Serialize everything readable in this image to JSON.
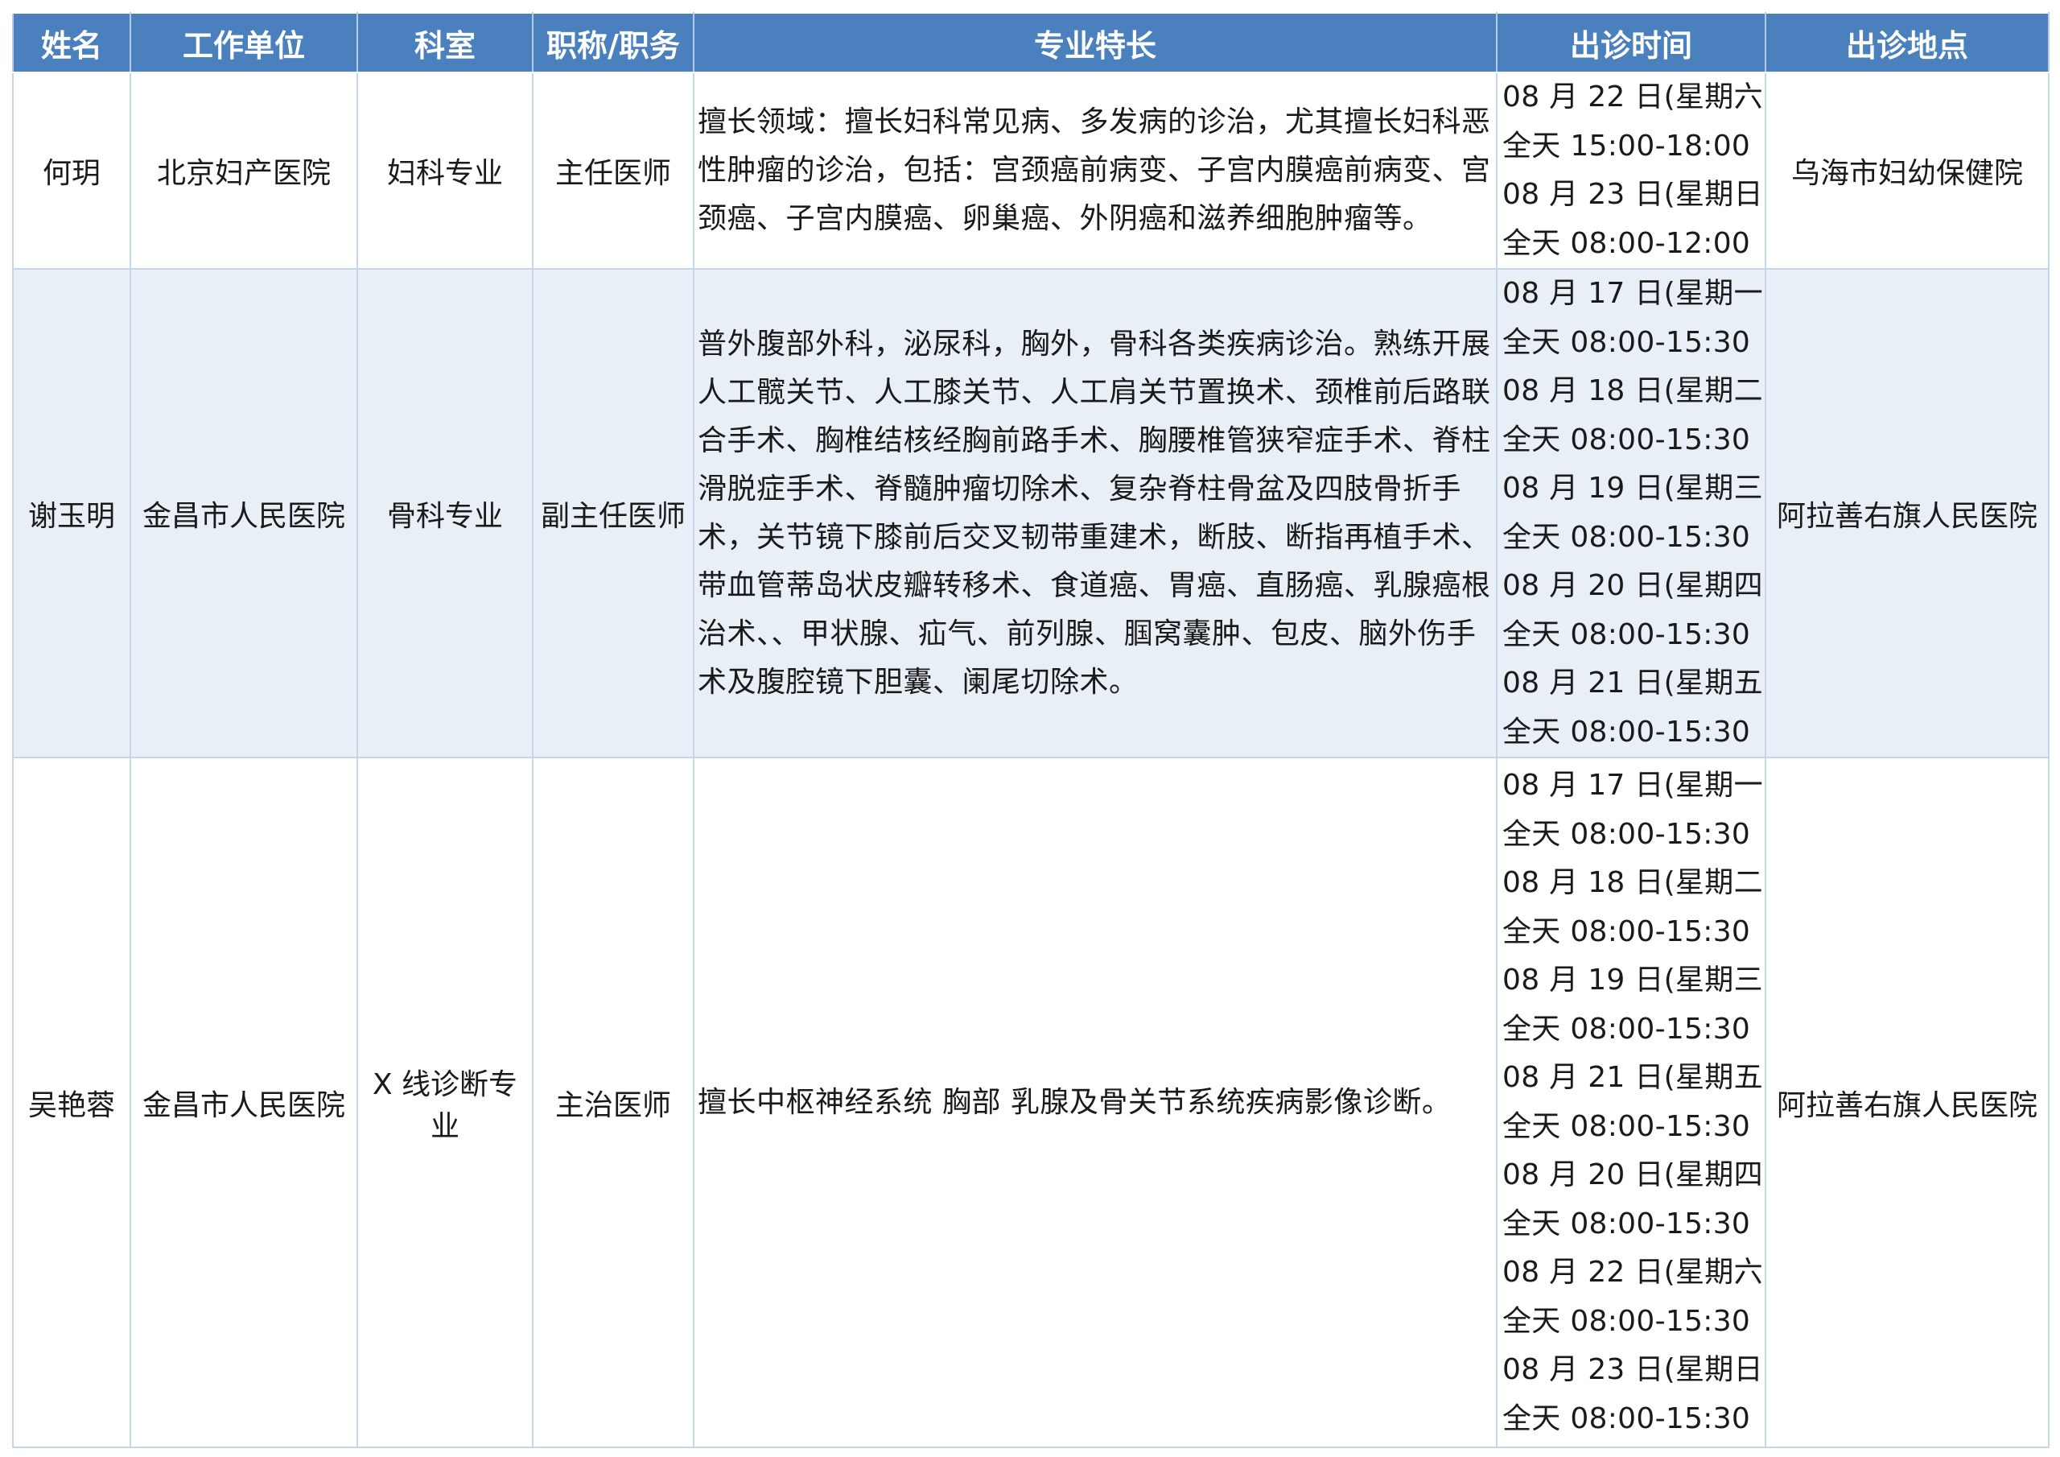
{
  "headers": [
    "姓名",
    "工作单位",
    "科室",
    "职称/职务",
    "专业特长",
    "出诊时间",
    "出诊地点"
  ],
  "doctors": [
    {
      "name": "何玥",
      "unit": "北京妇产医院",
      "dept": "妇科专业",
      "title": "主任医师",
      "specialty": "擅长领域：擅长妇科常见病、多发病的诊治，尤其擅长妇科恶性肿瘤的诊治，包括：宫颈癌前病变、子宫内膜癌前病变、宫颈癌、子宫内膜癌、卵巢癌、外阴癌和滋养细胞肿瘤等。",
      "schedule": [
        "08 月 22 日(星期六)",
        "全天 15:00-18:00",
        "08 月 23 日(星期日)",
        "全天 08:00-12:00"
      ],
      "location": "乌海市妇幼保健院"
    },
    {
      "name": "谢玉明",
      "unit": "金昌市人民医院",
      "dept": "骨科专业",
      "title": "副主任医师",
      "specialty": "普外腹部外科，泌尿科，胸外，骨科各类疾病诊治。熟练开展人工髋关节、人工膝关节、人工肩关节置换术、颈椎前后路联合手术、胸椎结核经胸前路手术、胸腰椎管狭窄症手术、脊柱滑脱症手术、脊髓肿瘤切除术、复杂脊柱骨盆及四肢骨折手术，关节镜下膝前后交叉韧带重建术，断肢、断指再植手术、带血管蒂岛状皮瓣转移术、食道癌、胃癌、直肠癌、乳腺癌根治术、、甲状腺、疝气、前列腺、腘窝囊肿、包皮、脑外伤手术及腹腔镜下胆囊、阑尾切除术。",
      "schedule": [
        "08 月 17 日(星期一)",
        "全天 08:00-15:30",
        "08 月 18 日(星期二)",
        "全天 08:00-15:30",
        "08 月 19 日(星期三)",
        "全天 08:00-15:30",
        "08 月 20 日(星期四)",
        "全天 08:00-15:30",
        "08 月 21 日(星期五)",
        "全天 08:00-15:30"
      ],
      "location": "阿拉善右旗人民医院"
    },
    {
      "name": "吴艳蓉",
      "unit": "金昌市人民医院",
      "dept": "X 线诊断专业",
      "title": "主治医师",
      "specialty": "擅长中枢神经系统 胸部 乳腺及骨关节系统疾病影像诊断。",
      "schedule": [
        "08 月 17 日(星期一)",
        "全天 08:00-15:30",
        "08 月 18 日(星期二)",
        "全天 08:00-15:30",
        "08 月 19 日(星期三)",
        "全天 08:00-15:30",
        "08 月 21 日(星期五)",
        "全天 08:00-15:30",
        "08 月 20 日(星期四)",
        "全天 08:00-15:30",
        "08 月 22 日(星期六)",
        "全天 08:00-15:30",
        "08 月 23 日(星期日)",
        "全天 08:00-15:30"
      ],
      "location": "阿拉善右旗人民医院"
    }
  ]
}
